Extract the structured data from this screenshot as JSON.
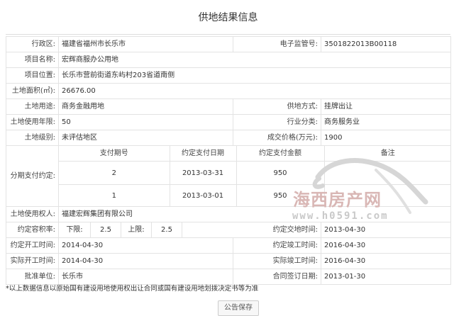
{
  "page": {
    "title": "供地结果信息"
  },
  "fields": {
    "district_label": "行政区:",
    "district_value": "福建省福州市长乐市",
    "supervision_label": "电子监管号:",
    "supervision_value": "3501822013B00118",
    "project_name_label": "项目名称:",
    "project_name_value": "宏辉商服办公用地",
    "project_location_label": "项目位置:",
    "project_location_value": "长乐市营前街道东屿村203省道南侧",
    "land_area_label": "土地面积(㎡):",
    "land_area_value": "26676.00",
    "land_use_label": "土地用途:",
    "land_use_value": "商务金融用地",
    "supply_method_label": "供地方式:",
    "supply_method_value": "挂牌出让",
    "use_years_label": "土地使用年限:",
    "use_years_value": "50",
    "industry_label": "行业分类:",
    "industry_value": "商务服务业",
    "land_level_label": "土地级别:",
    "land_level_value": "未评估地区",
    "deal_price_label": "成交价格(万元):",
    "deal_price_value": "1900",
    "installment_label": "分期支付约定:",
    "right_holder_label": "土地使用权人:",
    "right_holder_value": "福建宏辉集团有限公司",
    "plot_ratio_label": "约定容积率:",
    "lower_label": "下限:",
    "lower_value": "2.5",
    "upper_label": "上限:",
    "upper_value": "2.5",
    "handover_label": "约定交地时间:",
    "handover_value": "2013-04-30",
    "start_plan_label": "约定开工时间:",
    "start_plan_value": "2014-04-30",
    "finish_plan_label": "约定竣工时间:",
    "finish_plan_value": "2016-04-30",
    "start_actual_label": "实际开工时间:",
    "start_actual_value": "2014-04-30",
    "finish_actual_label": "实际竣工时间:",
    "finish_actual_value": "2016-04-30",
    "approval_label": "批准单位:",
    "approval_value": "长乐市",
    "contract_date_label": "合同签订日期:",
    "contract_date_value": "2013-01-30"
  },
  "payments": {
    "headers": [
      "支付期号",
      "约定支付日期",
      "约定支付金额",
      "备注"
    ],
    "rows": [
      {
        "period": "2",
        "date": "2013-03-31",
        "amount": "950",
        "remark": ""
      },
      {
        "period": "1",
        "date": "2013-03-01",
        "amount": "950",
        "remark": ""
      }
    ]
  },
  "note": "*以上数据信息以原始国有建设用地使用权出让合同或国有建设用地划拨决定书等为准",
  "buttons": {
    "save": "公告保存"
  },
  "watermark": {
    "name": "海西房产网",
    "url": "www.h0591.com"
  }
}
